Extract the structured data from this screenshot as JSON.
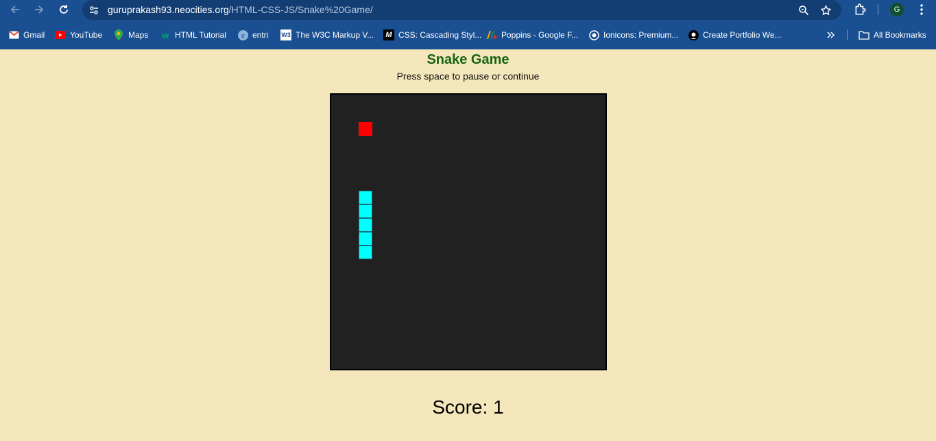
{
  "browser": {
    "url_host": "guruprakash93.neocities.org",
    "url_path": "/HTML-CSS-JS/Snake%20Game/",
    "profile_initial": "G"
  },
  "bookmarks": [
    {
      "label": "Gmail",
      "icon": "gmail-icon"
    },
    {
      "label": "YouTube",
      "icon": "youtube-icon"
    },
    {
      "label": "Maps",
      "icon": "maps-icon"
    },
    {
      "label": "HTML Tutorial",
      "icon": "w3schools-icon"
    },
    {
      "label": "entri",
      "icon": "entri-icon"
    },
    {
      "label": "The W3C Markup V...",
      "icon": "w3c-icon"
    },
    {
      "label": "CSS: Cascading Styl...",
      "icon": "mdn-icon"
    },
    {
      "label": "Poppins - Google F...",
      "icon": "google-fonts-icon"
    },
    {
      "label": "Ionicons: Premium...",
      "icon": "ionicons-icon"
    },
    {
      "label": "Create Portfolio We...",
      "icon": "github-icon"
    }
  ],
  "all_bookmarks": "All Bookmarks",
  "game": {
    "title": "Snake Game",
    "instructions": "Press space to pause or continue",
    "score_text": "Score: 1",
    "grid": {
      "columns": 20,
      "rows": 20
    },
    "food": {
      "col": 2,
      "row": 2
    },
    "snake": [
      {
        "col": 2,
        "row": 7
      },
      {
        "col": 2,
        "row": 8
      },
      {
        "col": 2,
        "row": 9
      },
      {
        "col": 2,
        "row": 10
      },
      {
        "col": 2,
        "row": 11
      }
    ]
  },
  "colors": {
    "page_bg": "#f5e7bc",
    "title": "#16650f",
    "board": "#212121",
    "food": "#ff0000",
    "snake": "#00ffff",
    "chrome": "#1a4f91"
  }
}
